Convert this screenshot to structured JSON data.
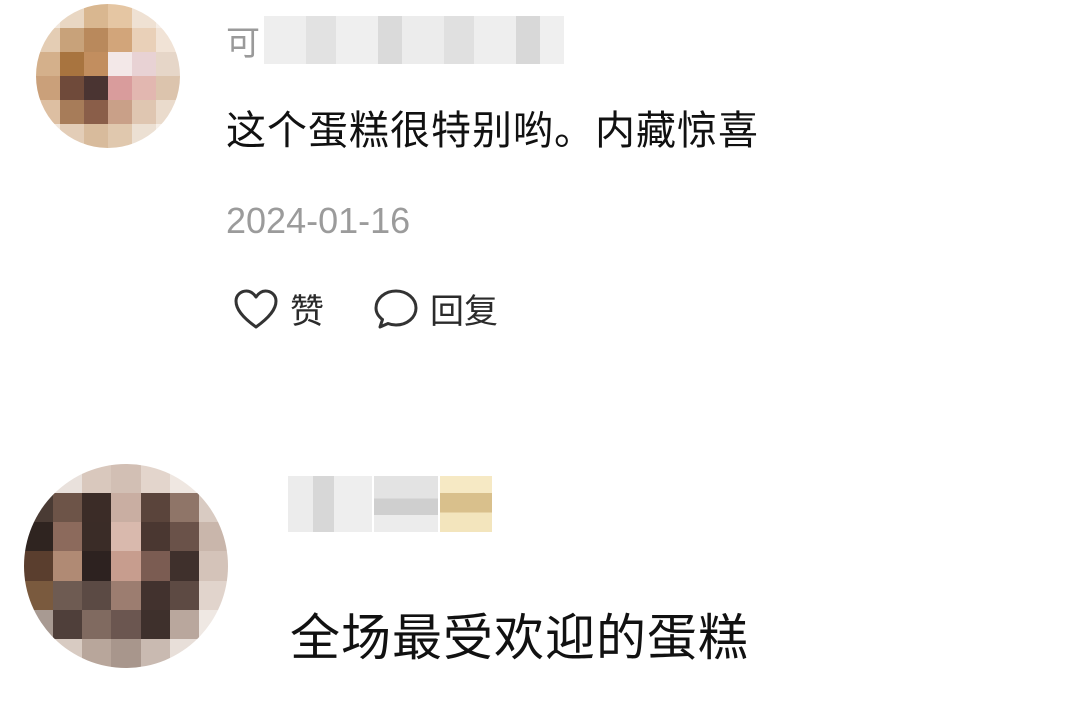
{
  "comments": [
    {
      "username_visible": "可",
      "text": "这个蛋糕很特别哟。内藏惊喜",
      "date": "2024-01-16",
      "like_label": "赞",
      "reply_label": "回复"
    },
    {
      "username_visible": "",
      "text": "全场最受欢迎的蛋糕"
    }
  ],
  "icons": {
    "like": "heart-outline-icon",
    "reply": "speech-bubble-outline-icon"
  }
}
